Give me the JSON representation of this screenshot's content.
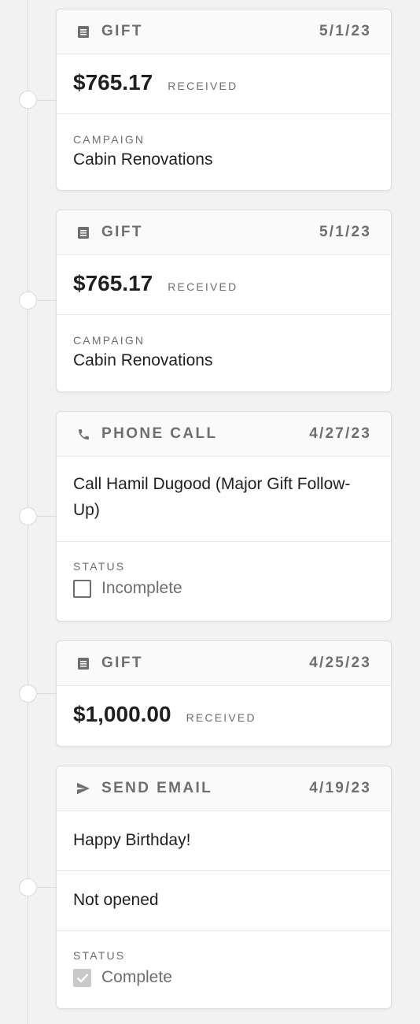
{
  "activities": [
    {
      "type": "GIFT",
      "icon": "receipt-icon",
      "date": "5/1/23",
      "amount": "$765.17",
      "amount_status": "RECEIVED",
      "campaign_label": "CAMPAIGN",
      "campaign": "Cabin Renovations"
    },
    {
      "type": "GIFT",
      "icon": "receipt-icon",
      "date": "5/1/23",
      "amount": "$765.17",
      "amount_status": "RECEIVED",
      "campaign_label": "CAMPAIGN",
      "campaign": "Cabin Renovations"
    },
    {
      "type": "PHONE CALL",
      "icon": "phone-icon",
      "date": "4/27/23",
      "description": "Call Hamil Dugood (Major Gift Follow-Up)",
      "status_label": "STATUS",
      "status": "Incomplete",
      "checked": false
    },
    {
      "type": "GIFT",
      "icon": "receipt-icon",
      "date": "4/25/23",
      "amount": "$1,000.00",
      "amount_status": "RECEIVED"
    },
    {
      "type": "SEND EMAIL",
      "icon": "send-icon",
      "date": "4/19/23",
      "subject": "Happy Birthday!",
      "open_status": "Not opened",
      "status_label": "STATUS",
      "status": "Complete",
      "checked": true
    }
  ]
}
